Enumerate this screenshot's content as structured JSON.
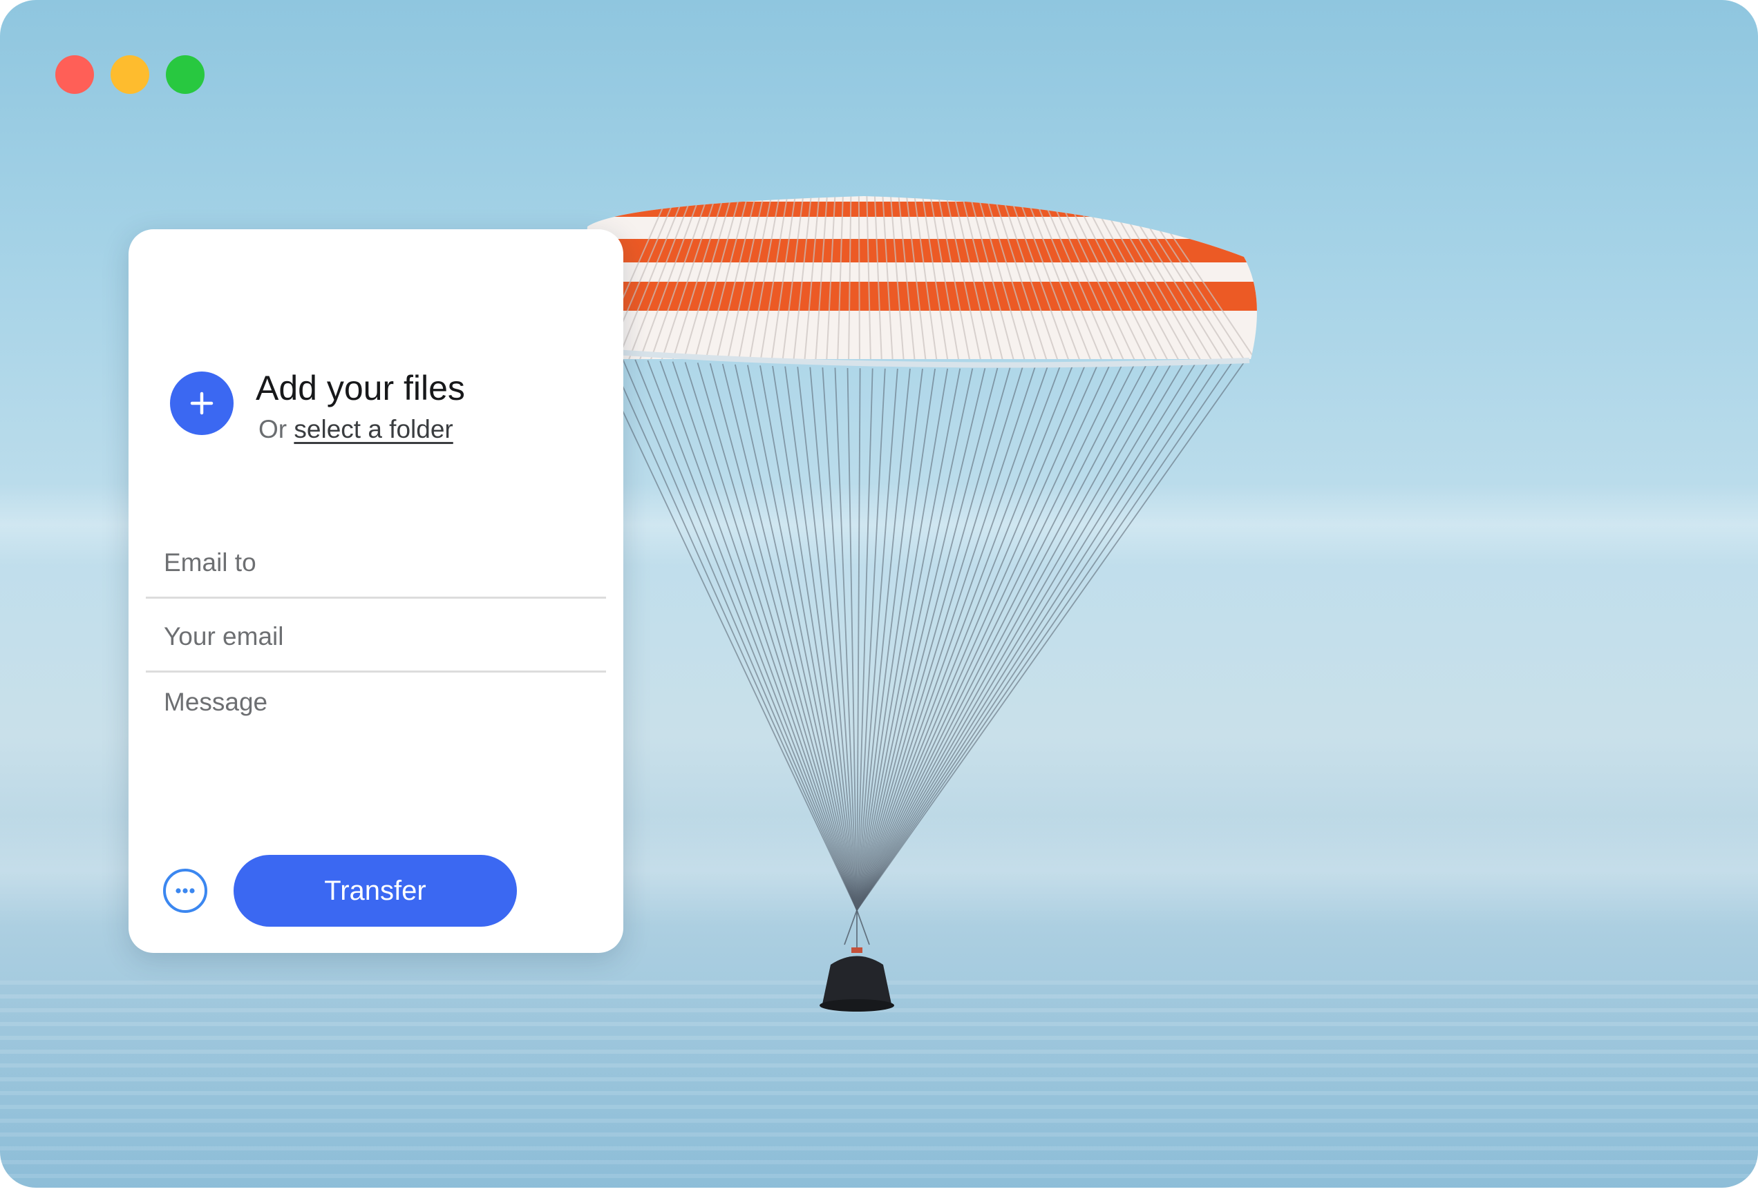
{
  "window": {
    "controls": [
      {
        "name": "close",
        "color": "#ff5f57"
      },
      {
        "name": "minimize",
        "color": "#febc2e"
      },
      {
        "name": "zoom",
        "color": "#28c840"
      }
    ]
  },
  "upload_panel": {
    "add_title": "Add your files",
    "add_sub_prefix": "Or",
    "select_folder_link": "select a folder",
    "fields": {
      "email_to": {
        "placeholder": "Email to",
        "value": ""
      },
      "your_email": {
        "placeholder": "Your email",
        "value": ""
      },
      "message": {
        "placeholder": "Message",
        "value": ""
      }
    },
    "transfer_label": "Transfer",
    "more_options_icon": "ellipsis-circle-icon",
    "add_icon": "plus-icon"
  },
  "background": {
    "subject": "parachute-image",
    "canopy_colors": [
      "#ec5a25",
      "#f7f2ef"
    ]
  },
  "colors": {
    "accent": "#3b68f2",
    "more_button_border": "#3b87f0"
  }
}
